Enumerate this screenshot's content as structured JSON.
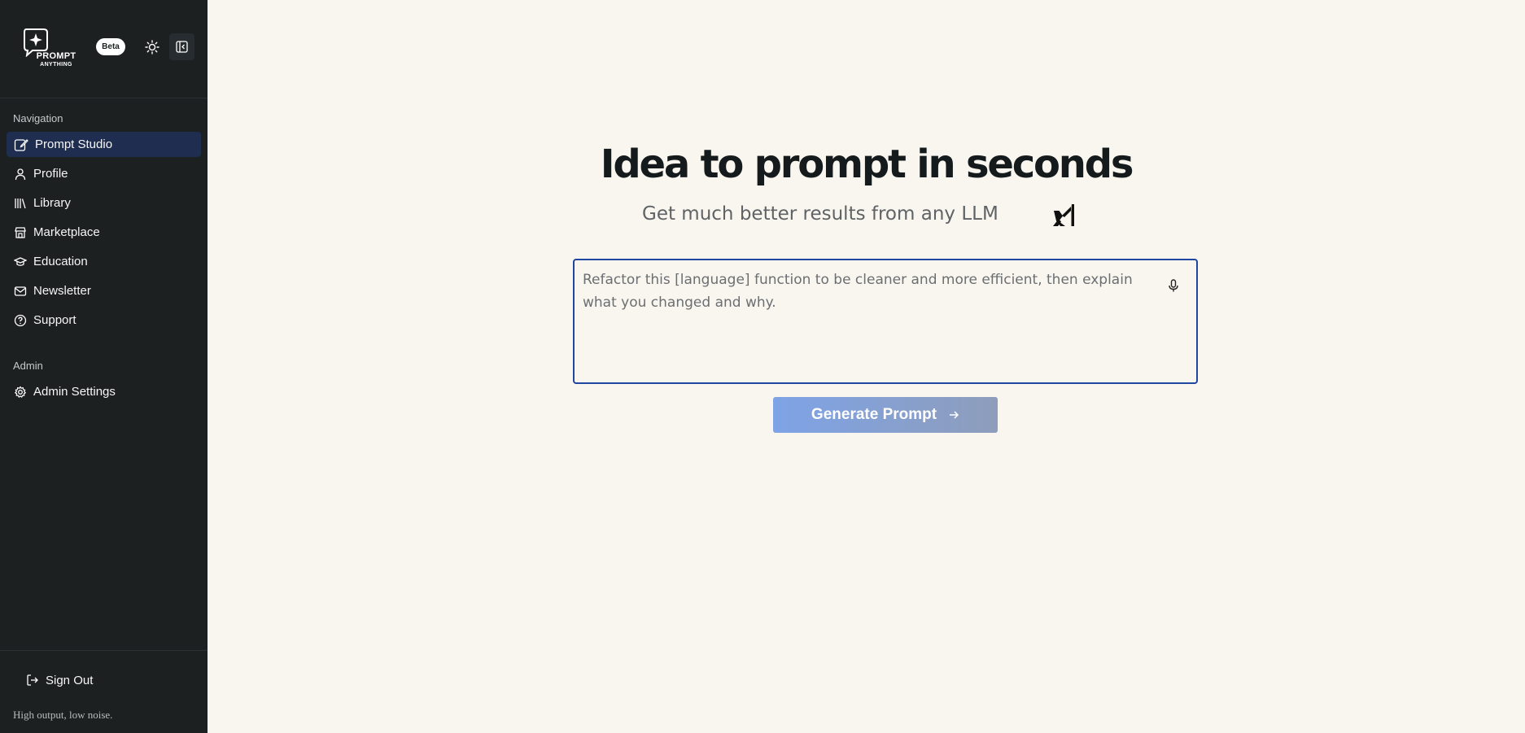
{
  "app": {
    "logo_line1": "PROMPT",
    "logo_line2": "ANYTHING",
    "badge": "Beta",
    "theme_icon": "sun-icon",
    "collapse_icon": "sidebar-collapse-icon"
  },
  "sidebar": {
    "nav_heading": "Navigation",
    "items": [
      {
        "label": "Prompt Studio",
        "icon": "edit-icon",
        "active": true
      },
      {
        "label": "Profile",
        "icon": "user-icon"
      },
      {
        "label": "Library",
        "icon": "library-icon"
      },
      {
        "label": "Marketplace",
        "icon": "store-icon"
      },
      {
        "label": "Education",
        "icon": "graduation-cap-icon"
      },
      {
        "label": "Newsletter",
        "icon": "mail-icon"
      },
      {
        "label": "Support",
        "icon": "help-circle-icon"
      }
    ],
    "admin_heading": "Admin",
    "admin_items": [
      {
        "label": "Admin Settings",
        "icon": "gear-icon"
      }
    ],
    "sign_out": "Sign Out",
    "tagline": "High output, low noise."
  },
  "main": {
    "title": "Idea to prompt in seconds",
    "subtitle": "Get much better results from any LLM",
    "brand_icon": "xai-logo-icon",
    "prompt_value": "Refactor this [language] function to be cleaner and more efficient, then explain what you changed and why.",
    "mic_icon": "microphone-icon",
    "generate_label": "Generate Prompt"
  },
  "colors": {
    "sidebar_bg": "#1c2021",
    "active_item_bg": "#1f2d50",
    "main_bg": "#f9f6ef",
    "input_border": "#1f46a0",
    "button_gradient_start": "#7ea3e6",
    "button_gradient_end": "#8e9dbb"
  }
}
